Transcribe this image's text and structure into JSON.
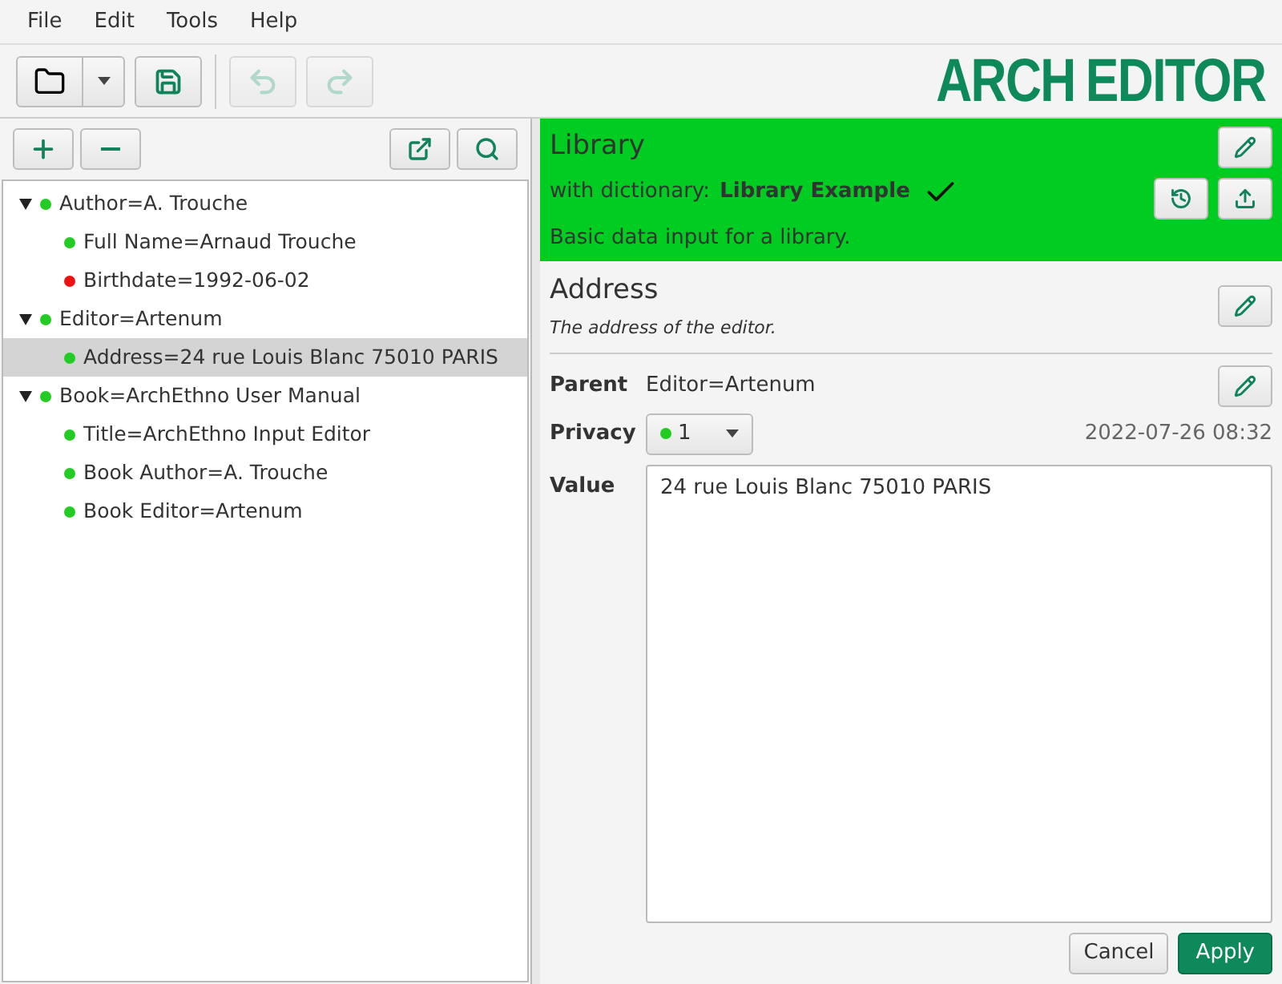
{
  "menu": [
    "File",
    "Edit",
    "Tools",
    "Help"
  ],
  "toolbar": {
    "undo": {
      "disabled": true
    },
    "redo": {
      "disabled": true
    }
  },
  "logo": {
    "part_1": "ARCH",
    "part_2": "EDITOR"
  },
  "tree": [
    {
      "label": "Author=A. Trouche",
      "color": "#22cc22",
      "expanded": true,
      "selected": false,
      "children": [
        {
          "label": "Full Name=Arnaud Trouche",
          "color": "#22cc22",
          "selected": false
        },
        {
          "label": "Birthdate=1992-06-02",
          "color": "#ee1111",
          "selected": false
        }
      ]
    },
    {
      "label": "Editor=Artenum",
      "color": "#22cc22",
      "expanded": true,
      "selected": false,
      "children": [
        {
          "label": "Address=24 rue Louis Blanc 75010 PARIS",
          "color": "#22cc22",
          "selected": true
        }
      ]
    },
    {
      "label": "Book=ArchEthno User Manual",
      "color": "#22cc22",
      "expanded": true,
      "selected": false,
      "children": [
        {
          "label": "Title=ArchEthno Input Editor",
          "color": "#22cc22",
          "selected": false
        },
        {
          "label": "Book Author=A. Trouche",
          "color": "#22cc22",
          "selected": false
        },
        {
          "label": "Book Editor=Artenum",
          "color": "#22cc22",
          "selected": false
        }
      ]
    }
  ],
  "header": {
    "title": "Library",
    "dictionary_label": "with dictionary:",
    "dictionary": "Library Example",
    "validated": true,
    "description": "Basic data input for a library."
  },
  "detail": {
    "title": "Address",
    "description": "The address of the editor.",
    "parent_label": "Parent",
    "parent": "Editor=Artenum",
    "privacy_label": "Privacy",
    "privacy": {
      "label": "1",
      "color": "#22cc22"
    },
    "timestamp": "2022-07-26 08:32",
    "value_label": "Value",
    "value": "24 rue Louis Blanc 75010 PARIS"
  },
  "buttons": [
    "Cancel",
    "Apply"
  ]
}
